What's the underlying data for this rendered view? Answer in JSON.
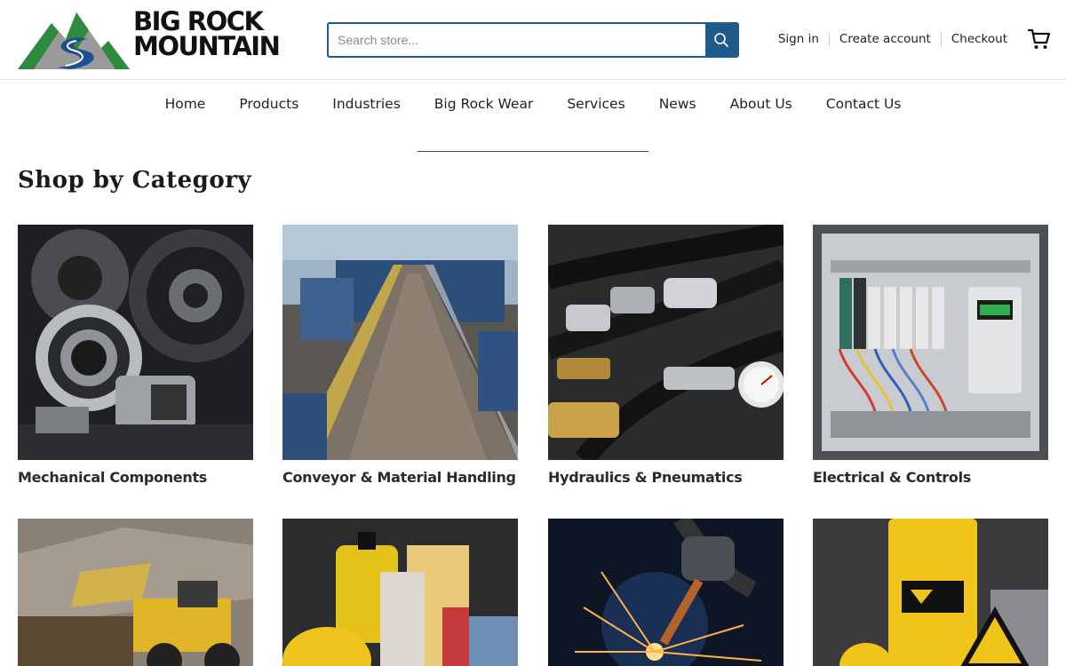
{
  "header": {
    "logo": {
      "line1": "BIG ROCK",
      "line2": "MOUNTAIN"
    },
    "search": {
      "placeholder": "Search store...",
      "icon": "search-icon"
    },
    "account": {
      "sign_in": "Sign in",
      "create_account": "Create account",
      "checkout": "Checkout"
    },
    "cart": {
      "icon": "cart-icon"
    }
  },
  "nav": {
    "items": [
      {
        "label": "Home"
      },
      {
        "label": "Products"
      },
      {
        "label": "Industries"
      },
      {
        "label": "Big Rock Wear"
      },
      {
        "label": "Services"
      },
      {
        "label": "News"
      },
      {
        "label": "About Us"
      },
      {
        "label": "Contact Us"
      }
    ]
  },
  "main": {
    "section_title": "Shop by Category",
    "categories": [
      {
        "label": "Mechanical Components"
      },
      {
        "label": "Conveyor & Material Handling"
      },
      {
        "label": "Hydraulics & Pneumatics"
      },
      {
        "label": "Electrical & Controls"
      },
      {
        "label": ""
      },
      {
        "label": ""
      },
      {
        "label": ""
      },
      {
        "label": ""
      }
    ]
  },
  "colors": {
    "brand_blue": "#1f5b8a",
    "logo_green": "#2e8b3e",
    "logo_blue": "#1d4f91",
    "text_dark": "#222222"
  }
}
